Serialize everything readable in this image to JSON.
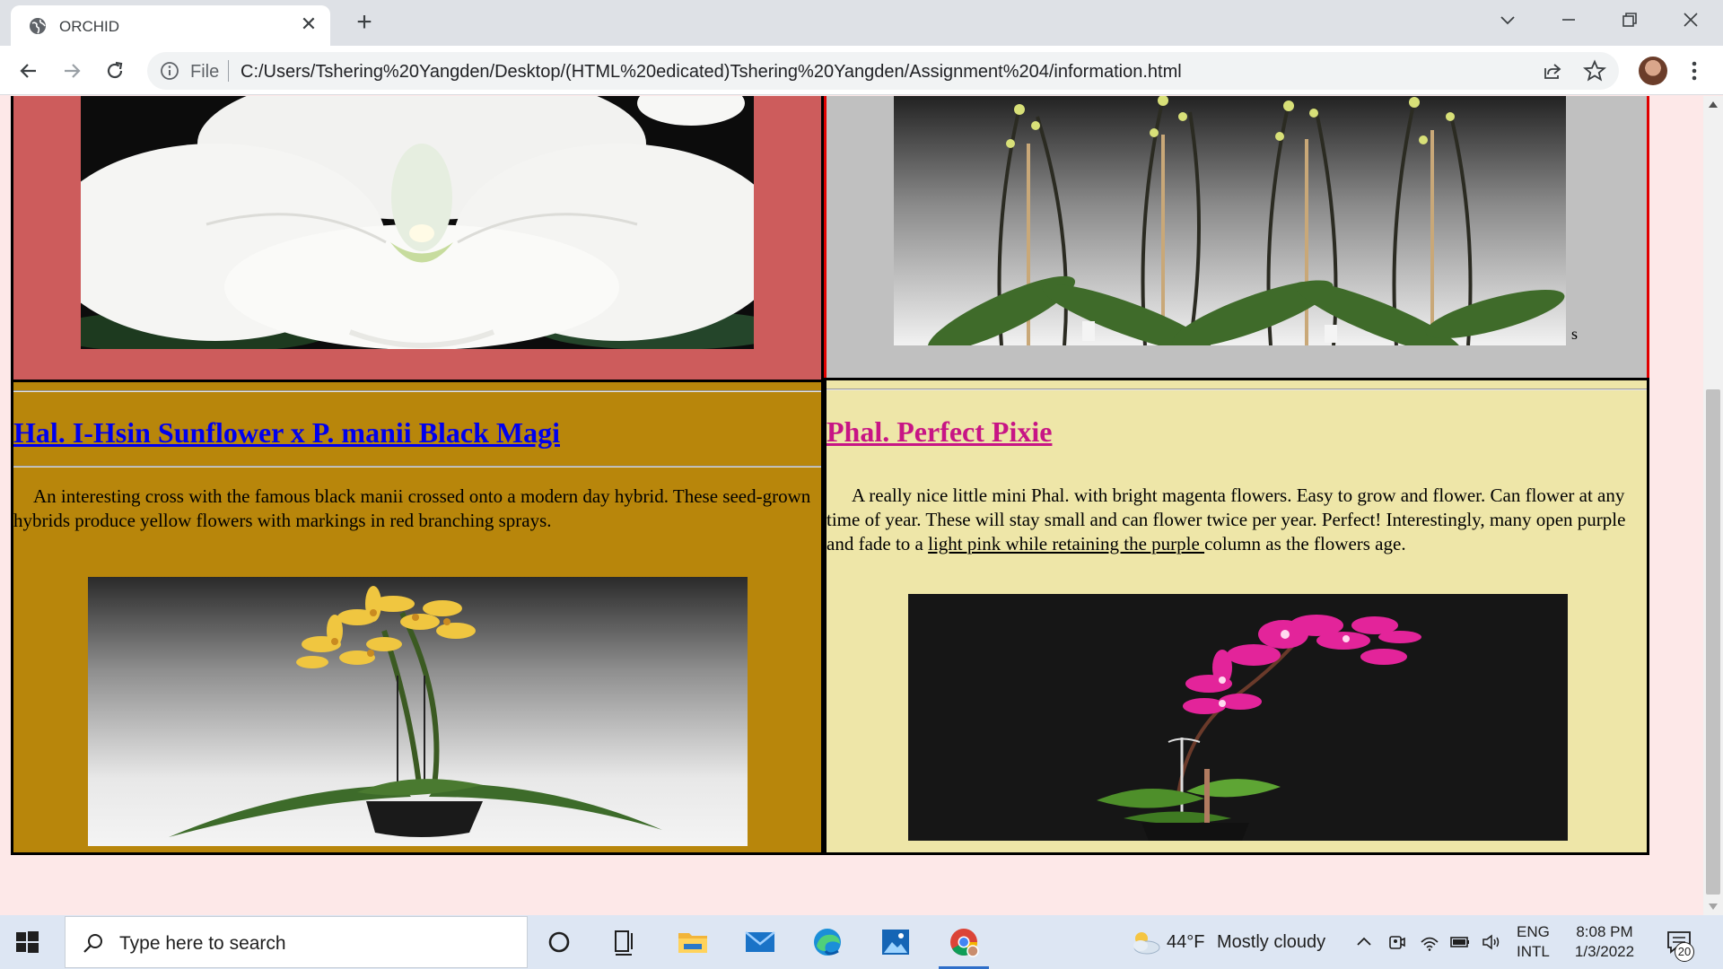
{
  "browser": {
    "tab_title": "ORCHID",
    "address_scheme": "File",
    "address_url": "C:/Users/Tshering%20Yangden/Desktop/(HTML%20edicated)Tshering%20Yangden/Assignment%204/information.html"
  },
  "page": {
    "top_right_marker": "s",
    "cards": [
      {
        "title": "Hal. I-Hsin Sunflower x P. manii Black Magi",
        "title_color": "#0000ee",
        "description": "An interesting cross with the famous black manii crossed onto a modern day hybrid. These seed-grown hybrids produce yellow flowers with markings in red branching sprays.",
        "background": "#b8860b"
      },
      {
        "title": "Phal. Perfect Pixie",
        "title_color": "#c71585",
        "description_before_link": "A really nice little mini Phal. with bright magenta flowers. Easy to grow and flower. Can flower at any time of year. These will stay small and can flower twice per year. Perfect! Interestingly, many open purple and fade to a ",
        "description_link": "light pink while retaining the purple ",
        "description_after_link": "column as the flowers age.",
        "background": "#eee6a8"
      }
    ]
  },
  "taskbar": {
    "search_placeholder": "Type here to search",
    "weather_temp": "44°F",
    "weather_condition": "Mostly cloudy",
    "language_line1": "ENG",
    "language_line2": "INTL",
    "time": "8:08 PM",
    "date": "1/3/2022",
    "notification_count": "20"
  }
}
